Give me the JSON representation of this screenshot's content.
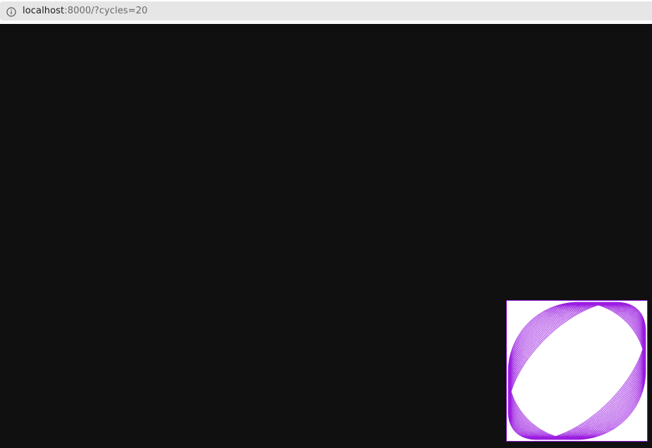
{
  "browser": {
    "url_host": "localhost",
    "url_rest": ":8000/?cycles=20",
    "info_icon": "info-icon"
  },
  "canvas": {
    "stroke_color": "#9b1de0",
    "background_color": "#ffffff",
    "cycles": 20
  }
}
